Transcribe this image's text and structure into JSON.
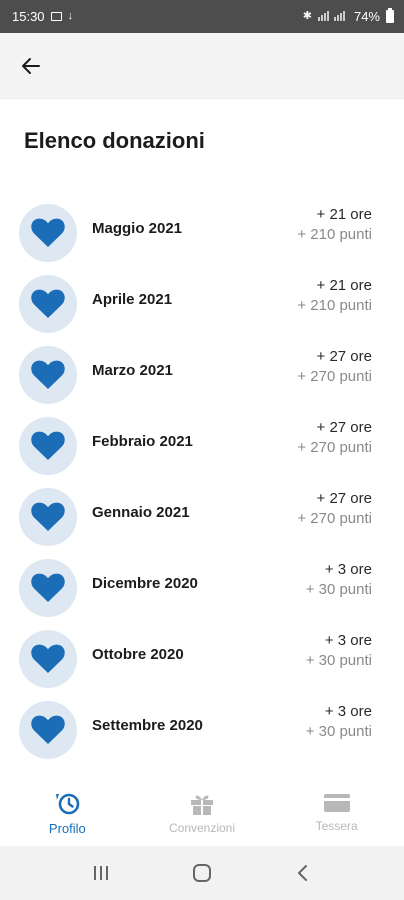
{
  "status_bar": {
    "time": "15:30",
    "battery": "74%"
  },
  "page": {
    "title": "Elenco donazioni"
  },
  "donations": [
    {
      "month": "Maggio 2021",
      "hours": "+ 21 ore",
      "points": "+ 210 punti"
    },
    {
      "month": "Aprile 2021",
      "hours": "+ 21 ore",
      "points": "+ 210 punti"
    },
    {
      "month": "Marzo 2021",
      "hours": "+ 27 ore",
      "points": "+ 270 punti"
    },
    {
      "month": "Febbraio 2021",
      "hours": "+ 27 ore",
      "points": "+ 270 punti"
    },
    {
      "month": "Gennaio 2021",
      "hours": "+ 27 ore",
      "points": "+ 270 punti"
    },
    {
      "month": "Dicembre 2020",
      "hours": "+ 3 ore",
      "points": "+ 30 punti"
    },
    {
      "month": "Ottobre 2020",
      "hours": "+ 3 ore",
      "points": "+ 30 punti"
    },
    {
      "month": "Settembre 2020",
      "hours": "+ 3 ore",
      "points": "+ 30 punti"
    }
  ],
  "bottom_nav": {
    "items": [
      {
        "label": "Profilo",
        "icon": "profile-history-icon",
        "active": true
      },
      {
        "label": "Convenzioni",
        "icon": "gift-icon",
        "active": false
      },
      {
        "label": "Tessera",
        "icon": "card-icon",
        "active": false
      }
    ]
  },
  "colors": {
    "accent": "#1a6db6",
    "heart": "#1a6db6",
    "heart_bg": "#dde8f2",
    "status_bar": "#4d4d4d",
    "inactive": "#b8b8b8"
  }
}
